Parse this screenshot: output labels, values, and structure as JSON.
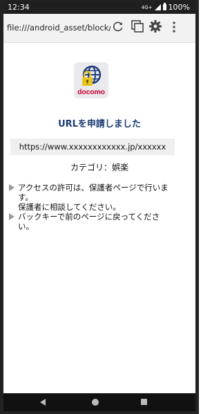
{
  "status_bar": {
    "time": "12:34",
    "network": "4G+",
    "battery": "100%"
  },
  "browser": {
    "url": "file:///android_asset/block/ap...",
    "icons": [
      "reload-icon",
      "tabs-icon",
      "gear-icon",
      "more-vert-icon"
    ]
  },
  "logo": {
    "brand": "docomo",
    "icon": "globe-lock-icon",
    "colors": {
      "globe": "#1b3a7a",
      "lock": "#e6c51d",
      "brand": "#cc0033"
    }
  },
  "page": {
    "title": "URLを申請しました",
    "requested_url": "https://www.xxxxxxxxxxxx.jp/xxxxxx",
    "category": "カテゴリ：娯楽",
    "messages": [
      {
        "lines": [
          "アクセスの許可は、保護者ページで行いま",
          "す。",
          "保護者に相談してください。"
        ]
      },
      {
        "lines": [
          "バックキーで前のページに戻ってくださ",
          "い。"
        ]
      }
    ]
  },
  "colors": {
    "title": "#1a3a73",
    "status_bar": "#1f1f1f",
    "nav_bar": "#111111"
  }
}
